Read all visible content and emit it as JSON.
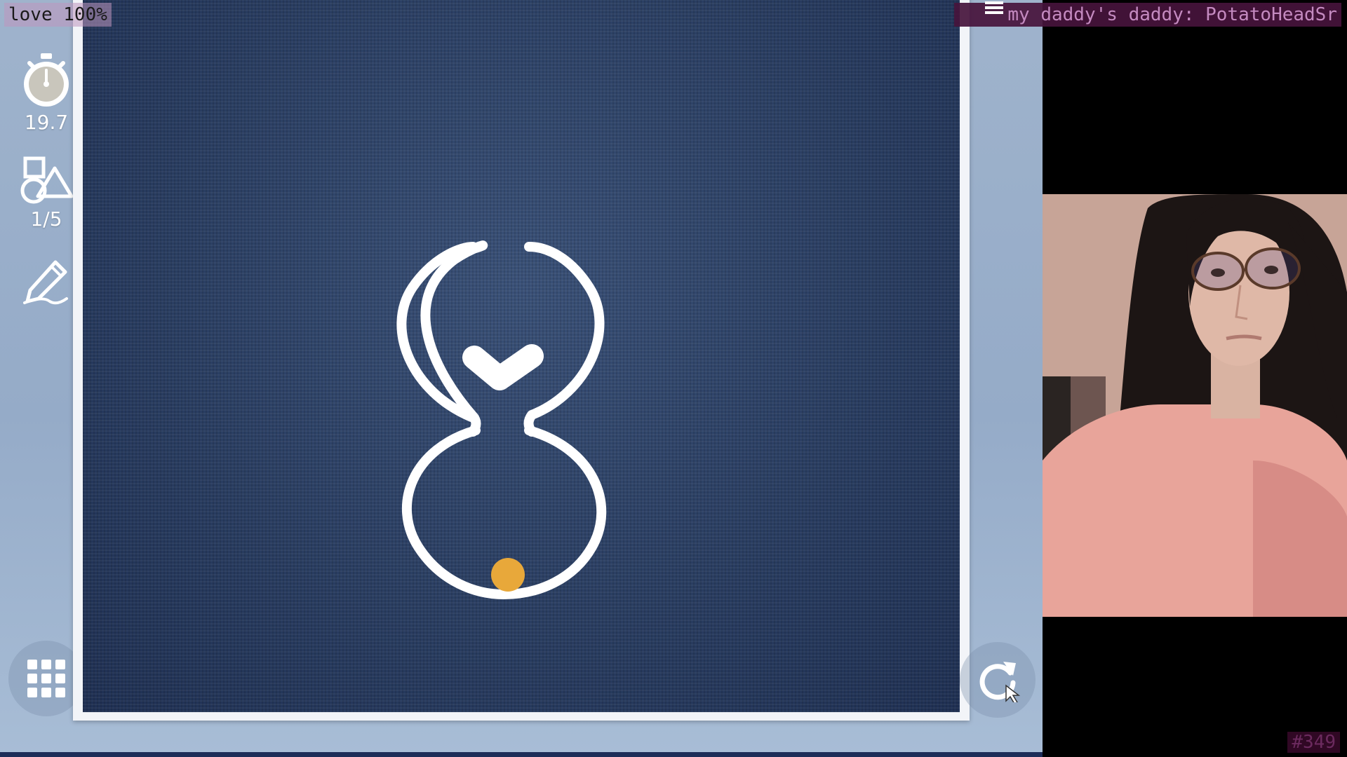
{
  "overlay": {
    "top_left": "love 100%",
    "top_right": "my daddy's daddy: PotatoHeadSr",
    "bottom_right": "#349"
  },
  "sidebar": {
    "timer": {
      "icon": "stopwatch-icon",
      "value": "19.7"
    },
    "shapes": {
      "icon": "shapes-icon",
      "value": "1/5"
    },
    "edit": {
      "icon": "pencil-icon"
    },
    "menu": {
      "icon": "grid-menu-icon"
    }
  },
  "board": {
    "icon": "restart-icon",
    "ball_color": "#e8a83a",
    "line_color": "#ffffff"
  },
  "colors": {
    "background": "#9fb3cc",
    "board": "#2a3f63",
    "overlay_accent": "#5b2a5b"
  }
}
